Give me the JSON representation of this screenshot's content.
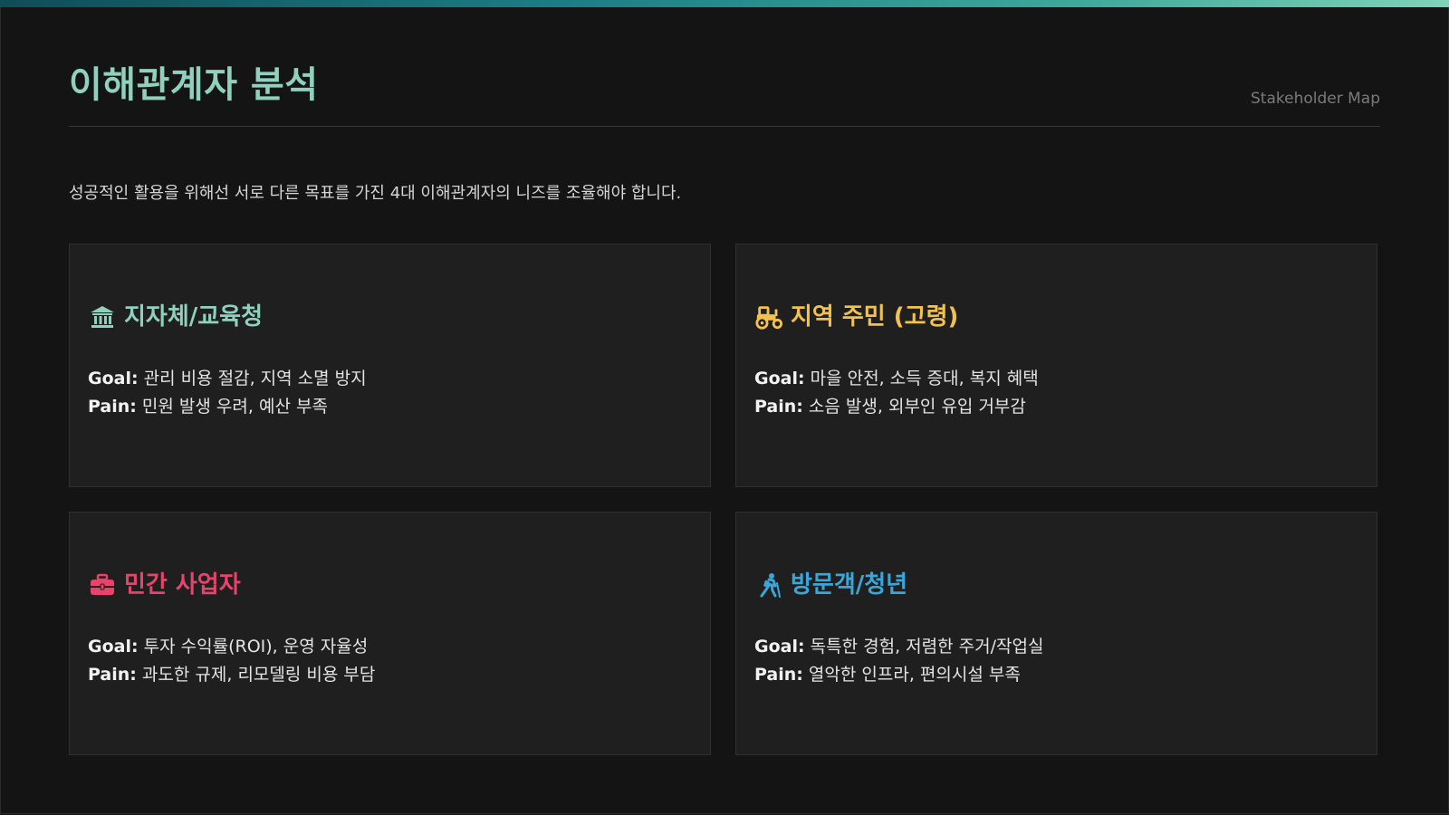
{
  "header": {
    "title": "이해관계자 분석",
    "subtitle": "Stakeholder Map"
  },
  "intro": "성공적인 활용을 위해선 서로 다른 목표를 가진 4대 이해관계자의 니즈를 조율해야 합니다.",
  "labels": {
    "goal": "Goal:",
    "pain": "Pain:"
  },
  "cards": [
    {
      "title": "지자체/교육청",
      "icon": "bank-icon",
      "color": "#8fd1bd",
      "goal": "관리 비용 절감, 지역 소멸 방지",
      "pain": "민원 발생 우려, 예산 부족"
    },
    {
      "title": "지역 주민 (고령)",
      "icon": "tractor-icon",
      "color": "#f2c14e",
      "goal": "마을 안전, 소득 증대, 복지 혜택",
      "pain": "소음 발생, 외부인 유입 거부감"
    },
    {
      "title": "민간 사업자",
      "icon": "briefcase-icon",
      "color": "#e8436b",
      "goal": "투자 수익률(ROI), 운영 자율성",
      "pain": "과도한 규제, 리모델링 비용 부담"
    },
    {
      "title": "방문객/청년",
      "icon": "hiker-icon",
      "color": "#3aa6d9",
      "goal": "독특한 경험, 저렴한 주거/작업실",
      "pain": "열악한 인프라, 편의시설 부족"
    }
  ]
}
